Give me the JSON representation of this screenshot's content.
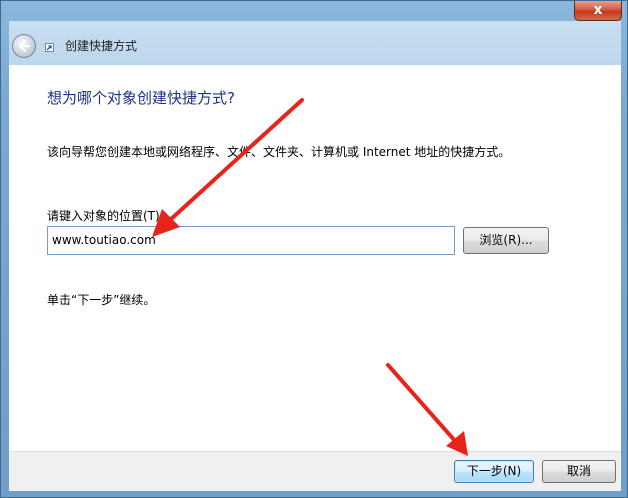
{
  "window": {
    "title": "创建快捷方式",
    "close_label": "x"
  },
  "wizard": {
    "heading": "想为哪个对象创建快捷方式?",
    "description": "该向导帮您创建本地或网络程序、文件、文件夹、计算机或 Internet 地址的快捷方式。",
    "location_label": "请键入对象的位置(T):",
    "location_value": "www.toutiao.com",
    "browse_label": "浏览(R)...",
    "hint": "单击“下一步”继续。"
  },
  "footer": {
    "next_label": "下一步(N)",
    "cancel_label": "取消"
  },
  "icons": {
    "back": "back-arrow-icon",
    "shortcut": "shortcut-icon",
    "close": "close-icon"
  },
  "colors": {
    "heading": "#1e3287",
    "annotation_arrow": "#e8231c",
    "aero_frame": "#6f9fc8",
    "close_button": "#c13a1e"
  }
}
